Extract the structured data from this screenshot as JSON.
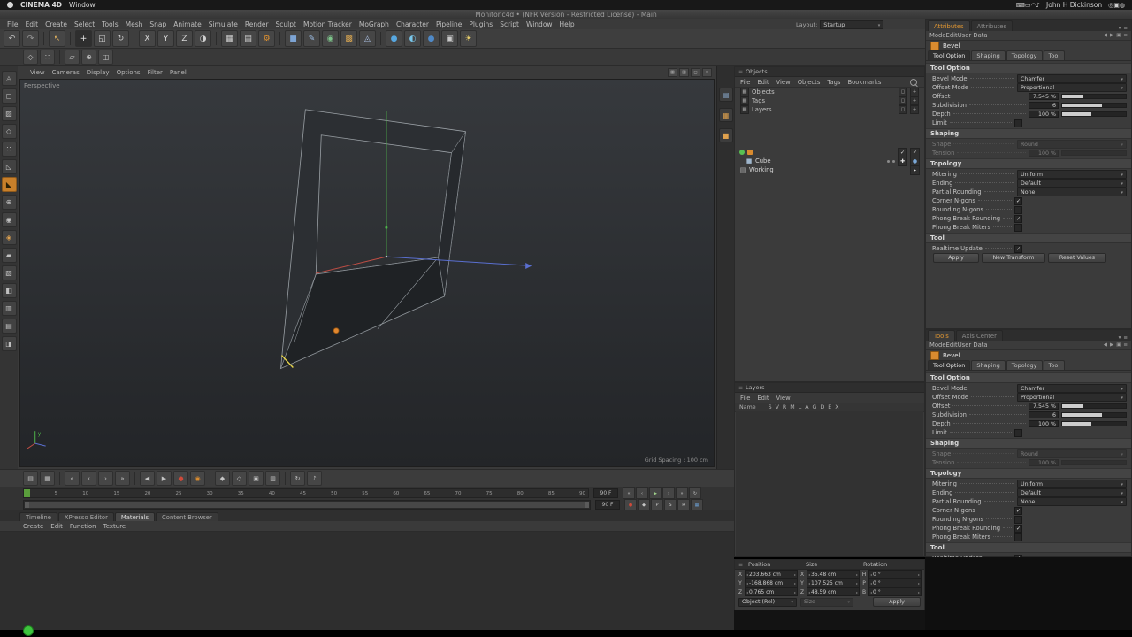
{
  "mac_bar": {
    "app": "CINEMA 4D",
    "menu": "Window",
    "user": "John H Dickinson",
    "icons_a": [
      {
        "name": "keyboard-icon",
        "g": "⌨"
      },
      {
        "name": "battery-icon",
        "g": "▭"
      },
      {
        "name": "wifi-icon",
        "g": "◠"
      },
      {
        "name": "volume-icon",
        "g": "♪"
      }
    ],
    "icons_b": [
      {
        "name": "spotlight-icon",
        "g": "◎"
      },
      {
        "name": "control-center-icon",
        "g": "▣"
      },
      {
        "name": "siri-icon",
        "g": "◍"
      }
    ]
  },
  "title_bar": {
    "title": "Monitor.c4d • (NFR Version - Restricted License) - Main"
  },
  "menu_bar": {
    "items": [
      "File",
      "Edit",
      "Create",
      "Select",
      "Tools",
      "Mesh",
      "Snap",
      "Animate",
      "Simulate",
      "Render",
      "Sculpt",
      "Motion Tracker",
      "MoGraph",
      "Character",
      "Pipeline",
      "Plugins",
      "Script",
      "Window",
      "Help"
    ],
    "layout_label": "Layout:",
    "layout_value": "Startup"
  },
  "toolbar": {
    "icons": [
      {
        "name": "undo-icon",
        "g": "↶",
        "fg": "#c8c8c8"
      },
      {
        "name": "redo-icon",
        "g": "↷",
        "fg": "#9a9a9a"
      },
      {
        "t": "sep"
      },
      {
        "name": "live-selection-icon",
        "g": "↖",
        "fg": "#e0b15e"
      },
      {
        "t": "sep"
      },
      {
        "name": "move-icon",
        "g": "+",
        "fg": "#eaeaea",
        "bg": "#2e2e2e"
      },
      {
        "name": "scale-icon",
        "g": "◱",
        "fg": "#cfcfcf"
      },
      {
        "name": "rotate-icon",
        "g": "↻",
        "fg": "#cfcfcf"
      },
      {
        "t": "sep"
      },
      {
        "name": "lock-x-axis-button",
        "g": "X",
        "fg": "#d8d8d8"
      },
      {
        "name": "lock-y-axis-button",
        "g": "Y",
        "fg": "#d8d8d8"
      },
      {
        "name": "lock-z-axis-button",
        "g": "Z",
        "fg": "#d8d8d8"
      },
      {
        "name": "coordinate-system-icon",
        "g": "◑",
        "fg": "#cfcfcf"
      },
      {
        "t": "sep"
      },
      {
        "name": "render-view-icon",
        "g": "▦",
        "fg": "#cfcfcf"
      },
      {
        "name": "render-picture-viewer-icon",
        "g": "▤",
        "fg": "#cfcfcf"
      },
      {
        "name": "render-settings-icon",
        "g": "⚙",
        "fg": "#e8962f"
      },
      {
        "t": "sep"
      },
      {
        "name": "add-cube-icon",
        "g": "■",
        "fg": "#7da4d4"
      },
      {
        "name": "spline-pen-icon",
        "g": "✎",
        "fg": "#9fc0e8"
      },
      {
        "name": "subdivision-surface-icon",
        "g": "◉",
        "fg": "#7dc48a"
      },
      {
        "name": "array-generator-icon",
        "g": "▩",
        "fg": "#d0a050"
      },
      {
        "name": "deformer-icon",
        "g": "◬",
        "fg": "#a8bde0"
      },
      {
        "t": "sep"
      },
      {
        "name": "environment-icon",
        "g": "●",
        "fg": "#57a7e0"
      },
      {
        "name": "sky-icon",
        "g": "◐",
        "fg": "#79c6ea"
      },
      {
        "name": "material-sphere-icon",
        "g": "●",
        "fg": "#4f89c7"
      },
      {
        "name": "camera-icon",
        "g": "▣",
        "fg": "#c9c9c9"
      },
      {
        "name": "light-icon",
        "g": "☀",
        "fg": "#ead06a"
      }
    ]
  },
  "subtoolbar": {
    "icons": [
      {
        "name": "snap-toggle-icon",
        "g": "◇",
        "fg": "#c9c9c9"
      },
      {
        "name": "quantize-icon",
        "g": "∷",
        "fg": "#c9c9c9"
      },
      {
        "t": "sep"
      },
      {
        "name": "workplane-icon",
        "g": "▱",
        "fg": "#c9c9c9"
      },
      {
        "name": "modeling-axis-icon",
        "g": "⊕",
        "fg": "#c9c9c9"
      },
      {
        "name": "axis-lock-icon",
        "g": "◫",
        "fg": "#c9c9c9"
      }
    ]
  },
  "leftbar": {
    "icons": [
      {
        "name": "make-editable-icon",
        "g": "◬",
        "fg": "#c0c0c0"
      },
      {
        "name": "model-mode-icon",
        "g": "◻",
        "fg": "#c0c0c0"
      },
      {
        "name": "texture-mode-icon",
        "g": "▨",
        "fg": "#c0c0c0"
      },
      {
        "name": "workplane-mode-icon",
        "g": "◇",
        "fg": "#c0c0c0"
      },
      {
        "name": "points-mode-icon",
        "g": "∷",
        "fg": "#c0c0c0"
      },
      {
        "name": "edges-mode-icon",
        "g": "◺",
        "fg": "#c0c0c0"
      },
      {
        "name": "polygons-mode-icon",
        "g": "◣",
        "fg": "#2b2006",
        "active": true
      },
      {
        "name": "enable-axis-icon",
        "g": "⊕",
        "fg": "#c0c0c0"
      },
      {
        "name": "viewport-solo-icon",
        "g": "◉",
        "fg": "#c0c0c0"
      },
      {
        "name": "snap-icon",
        "g": "◈",
        "fg": "#e0a24e"
      },
      {
        "name": "locked-workplane-icon",
        "g": "▰",
        "fg": "#c0c0c0"
      },
      {
        "name": "texture-axis-icon",
        "g": "▧",
        "fg": "#c0c0c0"
      },
      {
        "name": "compositing-icon",
        "g": "◧",
        "fg": "#c0c0c0"
      },
      {
        "name": "layer-color-icon",
        "g": "▥",
        "fg": "#c0c0c0"
      },
      {
        "name": "display-filter-icon",
        "g": "▤",
        "fg": "#c0c0c0"
      },
      {
        "name": "history-icon",
        "g": "◨",
        "fg": "#c0c0c0"
      }
    ]
  },
  "viewport": {
    "menu": [
      "View",
      "Cameras",
      "Display",
      "Options",
      "Filter",
      "Panel"
    ],
    "menu_icons": [
      {
        "name": "view-layout-single-icon",
        "g": "▦"
      },
      {
        "name": "view-layout-quad-icon",
        "g": "▥"
      },
      {
        "name": "view-maximize-icon",
        "g": "◻"
      },
      {
        "name": "view-options-icon",
        "g": "▾"
      }
    ],
    "label": "Perspective",
    "grid": "Grid Spacing : 100 cm",
    "axis_y": "y"
  },
  "dock": {
    "icons": [
      {
        "name": "dock-coordinates-icon",
        "g": "▤",
        "fg": "#8fb2d8"
      },
      {
        "name": "dock-objects-icon",
        "g": "▦",
        "fg": "#e0a24e"
      },
      {
        "name": "dock-structure-icon",
        "g": "■",
        "fg": "#e0a24e"
      }
    ]
  },
  "objects": {
    "title": "Objects",
    "menu": [
      "File",
      "Edit",
      "View",
      "Objects",
      "Tags",
      "Bookmarks"
    ],
    "filters": [
      "Objects",
      "Tags",
      "Layers"
    ],
    "rows": [
      {
        "label": "Cube"
      },
      {
        "label": "Working"
      }
    ]
  },
  "layers": {
    "title": "Layers",
    "menu": [
      "File",
      "Edit",
      "View"
    ],
    "name_col": "Name",
    "cols": [
      "S",
      "V",
      "R",
      "M",
      "L",
      "A",
      "G",
      "D",
      "E",
      "X"
    ]
  },
  "coords": {
    "headers": [
      "Position",
      "Size",
      "Rotation"
    ],
    "position": [
      {
        "k": "X",
        "v": "203.663 cm"
      },
      {
        "k": "Y",
        "v": "-168.868 cm"
      },
      {
        "k": "Z",
        "v": "0.765 cm"
      }
    ],
    "size": [
      {
        "k": "X",
        "v": "35.48 cm"
      },
      {
        "k": "Y",
        "v": "107.525 cm"
      },
      {
        "k": "Z",
        "v": "48.59 cm"
      }
    ],
    "rotation": [
      {
        "k": "H",
        "v": "0 °"
      },
      {
        "k": "P",
        "v": "0 °"
      },
      {
        "k": "B",
        "v": "0 °"
      }
    ],
    "mode1": "Object (Rel)",
    "mode2": "Size",
    "apply": "Apply"
  },
  "attr_top": {
    "tab_active": "Attributes",
    "tab_inactive": "Attributes"
  },
  "attr_bottom": {
    "tab_active": "Tools",
    "tab_inactive": "Axis Center"
  },
  "attr_common": {
    "menu": [
      "Mode",
      "Edit",
      "User Data"
    ],
    "menu_icons": [
      {
        "name": "history-back-icon",
        "g": "◀"
      },
      {
        "name": "history-forward-icon",
        "g": "▶"
      },
      {
        "name": "lock-icon",
        "g": "▣"
      },
      {
        "name": "panel-menu-icon",
        "g": "≡"
      }
    ],
    "object": "Bevel",
    "tabs2": [
      {
        "label": "Tool Option",
        "active": true
      },
      {
        "label": "Shaping"
      },
      {
        "label": "Topology"
      },
      {
        "label": "Tool"
      }
    ],
    "rows": [
      {
        "t": "sec",
        "label": "Tool Option"
      },
      {
        "t": "dd",
        "label": "Bevel Mode",
        "value": "Chamfer"
      },
      {
        "t": "dd",
        "label": "Offset Mode",
        "value": "Proportional"
      },
      {
        "t": "sl",
        "label": "Offset",
        "value": "7.545 %",
        "fill": 34
      },
      {
        "t": "sl",
        "label": "Subdivision",
        "value": "6",
        "fill": 62
      },
      {
        "t": "sl",
        "label": "Depth",
        "value": "100 %",
        "fill": 46
      },
      {
        "t": "ck",
        "label": "Limit"
      },
      {
        "t": "sec",
        "label": "Shaping"
      },
      {
        "t": "dd",
        "label": "Shape",
        "value": "Round",
        "dis": true
      },
      {
        "t": "sl",
        "label": "Tension",
        "value": "100 %",
        "fill": 0,
        "dis": true
      },
      {
        "t": "sec",
        "label": "Topology"
      },
      {
        "t": "dd",
        "label": "Mitering",
        "value": "Uniform"
      },
      {
        "t": "dd",
        "label": "Ending",
        "value": "Default"
      },
      {
        "t": "dd",
        "label": "Partial Rounding",
        "value": "None"
      },
      {
        "t": "ck",
        "label": "Corner N-gons",
        "on": true
      },
      {
        "t": "ck",
        "label": "Rounding N-gons"
      },
      {
        "t": "ck",
        "label": "Phong Break Rounding",
        "on": true
      },
      {
        "t": "ck",
        "label": "Phong Break Miters"
      },
      {
        "t": "sec",
        "label": "Tool"
      },
      {
        "t": "ck",
        "label": "Realtime Update",
        "on": true
      },
      {
        "t": "btns",
        "b1": "Apply",
        "b2": "New Transform",
        "b3": "Reset Values"
      }
    ]
  },
  "anim": {
    "icons": [
      {
        "name": "timeline-layout-icon",
        "g": "▤",
        "fg": "#c4c4c4"
      },
      {
        "name": "fcurve-layout-icon",
        "g": "▦",
        "fg": "#c4c4c4"
      },
      {
        "t": "sep"
      },
      {
        "name": "goto-start-icon",
        "g": "«",
        "fg": "#c4c4c4"
      },
      {
        "name": "prev-key-icon",
        "g": "‹",
        "fg": "#c4c4c4"
      },
      {
        "name": "next-key-icon",
        "g": "›",
        "fg": "#c4c4c4"
      },
      {
        "name": "goto-end-icon",
        "g": "»",
        "fg": "#c4c4c4"
      },
      {
        "t": "sep"
      },
      {
        "name": "prev-frame-icon",
        "g": "◀",
        "fg": "#c4c4c4"
      },
      {
        "name": "next-frame-icon",
        "g": "▶",
        "fg": "#c4c4c4"
      },
      {
        "name": "record-objects-icon",
        "g": "●",
        "fg": "#cf4a3a"
      },
      {
        "name": "autokeying-icon",
        "g": "◉",
        "fg": "#d98b2f"
      },
      {
        "t": "sep"
      },
      {
        "name": "record-position-icon",
        "g": "◆",
        "fg": "#c4c4c4"
      },
      {
        "name": "record-scale-icon",
        "g": "◇",
        "fg": "#c4c4c4"
      },
      {
        "name": "record-rotation-icon",
        "g": "▣",
        "fg": "#c4c4c4"
      },
      {
        "name": "record-parameter-icon",
        "g": "▥",
        "fg": "#c4c4c4"
      },
      {
        "t": "sep"
      },
      {
        "name": "playback-loop-icon",
        "g": "↻",
        "fg": "#c4c4c4"
      },
      {
        "name": "sound-icon",
        "g": "♪",
        "fg": "#c4c4c4"
      }
    ],
    "frames": [
      "0",
      "5",
      "10",
      "15",
      "20",
      "25",
      "30",
      "35",
      "40",
      "45",
      "50",
      "55",
      "60",
      "65",
      "70",
      "75",
      "80",
      "85",
      "90"
    ],
    "end_field": "90 F",
    "range_field": "90 F",
    "transport": [
      {
        "name": "goto-start-button",
        "g": "«",
        "fg": "#c6c6c6"
      },
      {
        "name": "prev-frame-button",
        "g": "‹",
        "fg": "#c6c6c6"
      },
      {
        "name": "play-button",
        "g": "▶",
        "fg": "#9fd08a"
      },
      {
        "name": "next-frame-button",
        "g": "›",
        "fg": "#c6c6c6"
      },
      {
        "name": "goto-end-button",
        "g": "»",
        "fg": "#c6c6c6"
      },
      {
        "name": "loop-button",
        "g": "↻",
        "fg": "#c6c6c6"
      }
    ],
    "record": [
      {
        "name": "record-keyframe-button",
        "g": "●",
        "fg": "#cf4a3a"
      },
      {
        "name": "keyframe-selection-button",
        "g": "◆",
        "fg": "#c6c6c6"
      },
      {
        "name": "record-position-button",
        "g": "P",
        "fg": "#c6c6c6"
      },
      {
        "name": "record-scale-button",
        "g": "S",
        "fg": "#c6c6c6"
      },
      {
        "name": "record-rotation-button",
        "g": "R",
        "fg": "#c6c6c6"
      },
      {
        "name": "record-pla-button",
        "g": "▦",
        "fg": "#6b9fd4"
      }
    ]
  },
  "bottom": {
    "tabs": [
      {
        "label": "Timeline"
      },
      {
        "label": "XPresso Editor"
      },
      {
        "label": "Materials",
        "active": true
      },
      {
        "label": "Content Browser"
      }
    ],
    "menu": [
      "Create",
      "Edit",
      "Function",
      "Texture"
    ]
  }
}
